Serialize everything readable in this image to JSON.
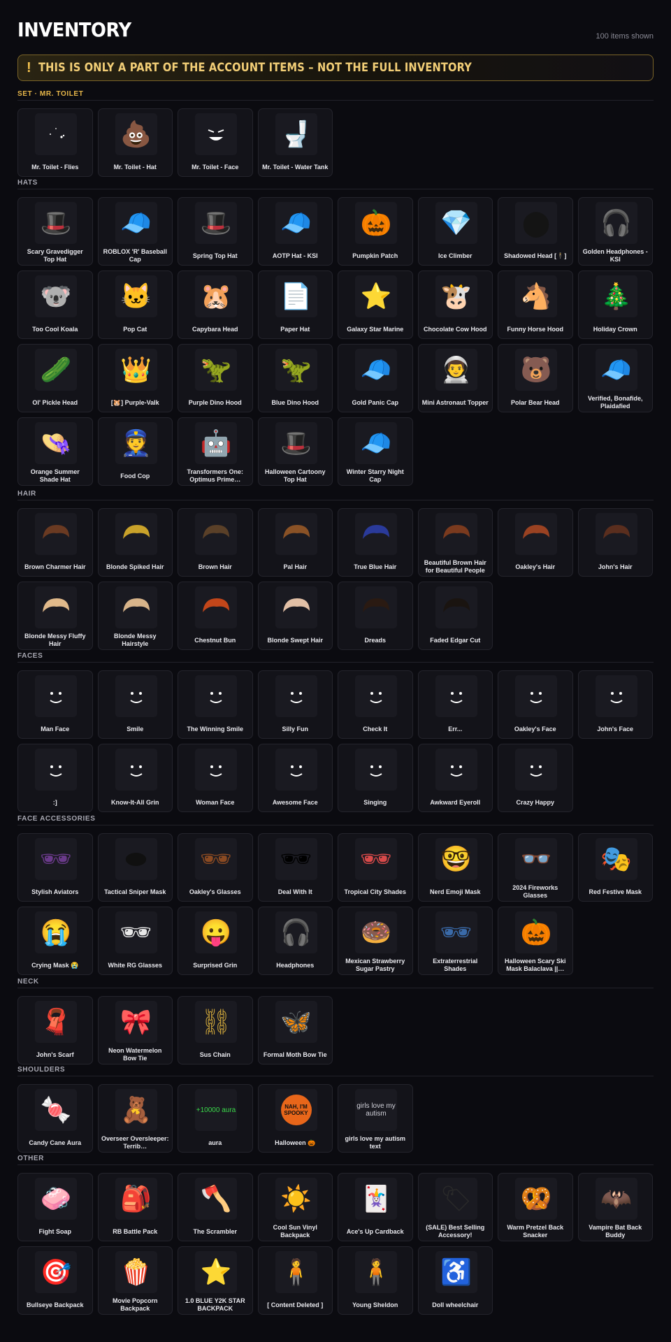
{
  "page": {
    "title": "INVENTORY",
    "count_label": "100 items shown",
    "banner_text": "THIS IS ONLY A PART OF THE ACCOUNT ITEMS – NOT THE FULL INVENTORY"
  },
  "sections": [
    {
      "label": "SET · MR. TOILET",
      "accent": "#e8b84a",
      "items": [
        {
          "name": "Mr. Toilet - Flies",
          "icon": "flies-icon",
          "color": "#ffffff"
        },
        {
          "name": "Mr. Toilet - Hat",
          "icon": "poop-hat-icon",
          "color": "#6b4a2e"
        },
        {
          "name": "Mr. Toilet - Face",
          "icon": "grin-face-icon",
          "color": "#ffffff"
        },
        {
          "name": "Mr. Toilet - Water Tank",
          "icon": "water-tank-icon",
          "color": "#c9c9c9"
        }
      ]
    },
    {
      "label": "HATS",
      "accent": "#a8a8b2",
      "items": [
        {
          "name": "Scary Gravedigger Top Hat",
          "icon": "top-hat-icon",
          "color": "#2b2b30"
        },
        {
          "name": "ROBLOX 'R' Baseball Cap",
          "icon": "cap-icon",
          "color": "#d12b2b"
        },
        {
          "name": "Spring Top Hat",
          "icon": "top-hat-icon",
          "color": "#2e8b3a"
        },
        {
          "name": "AOTP Hat - KSI",
          "icon": "cap-icon",
          "color": "#b33a2a"
        },
        {
          "name": "Pumpkin Patch",
          "icon": "pumpkin-icon",
          "color": "#f0b21a"
        },
        {
          "name": "Ice Climber",
          "icon": "crystal-icon",
          "color": "#4fa6d8"
        },
        {
          "name": "Shadowed Head [🕴]",
          "icon": "shadow-head-icon",
          "color": "#141414"
        },
        {
          "name": "Golden Headphones - KSI",
          "icon": "headphones-icon",
          "color": "#c9a23a"
        },
        {
          "name": "Too Cool Koala",
          "icon": "koala-icon",
          "color": "#8c8f95"
        },
        {
          "name": "Pop Cat",
          "icon": "cat-icon",
          "color": "#efe6d6"
        },
        {
          "name": "Capybara Head",
          "icon": "capybara-icon",
          "color": "#9a6a44"
        },
        {
          "name": "Paper Hat",
          "icon": "paper-hat-icon",
          "color": "#e9e9e9"
        },
        {
          "name": "Galaxy Star Marine",
          "icon": "star-hat-icon",
          "color": "#5b5fa8"
        },
        {
          "name": "Chocolate Cow Hood",
          "icon": "cow-icon",
          "color": "#f2ece2"
        },
        {
          "name": "Funny Horse Hood",
          "icon": "horse-icon",
          "color": "#a9693a"
        },
        {
          "name": "Holiday Crown",
          "icon": "wreath-icon",
          "color": "#2f8a3a"
        },
        {
          "name": "Ol' Pickle Head",
          "icon": "pickle-icon",
          "color": "#8da13a"
        },
        {
          "name": "[🐹] Purple-Valk",
          "icon": "valk-icon",
          "color": "#8b3fd6"
        },
        {
          "name": "Purple Dino Hood",
          "icon": "dino-icon",
          "color": "#8e4fd8"
        },
        {
          "name": "Blue Dino Hood",
          "icon": "dino-icon",
          "color": "#3a8ed8"
        },
        {
          "name": "Gold Panic Cap",
          "icon": "cap-icon",
          "color": "#d7b23a"
        },
        {
          "name": "Mini Astronaut Topper",
          "icon": "astronaut-icon",
          "color": "#c9ccd6"
        },
        {
          "name": "Polar Bear Head",
          "icon": "bear-icon",
          "color": "#d8d8d2"
        },
        {
          "name": "Verified, Bonafide, Plaidafied",
          "icon": "plaid-cap-icon",
          "color": "#4f9a6a"
        },
        {
          "name": "Orange Summer Shade Hat",
          "icon": "bucket-hat-icon",
          "color": "#c97a2a"
        },
        {
          "name": "Food Cop",
          "icon": "cop-icon",
          "color": "#2e3a66"
        },
        {
          "name": "Transformers One: Optimus Prime…",
          "icon": "robot-head-icon",
          "color": "#2a3a6a"
        },
        {
          "name": "Halloween Cartoony Top Hat",
          "icon": "top-hat-icon",
          "color": "#000000"
        },
        {
          "name": "Winter Starry Night Cap",
          "icon": "cap-icon",
          "color": "#6a9ad8"
        }
      ]
    },
    {
      "label": "HAIR",
      "accent": "#a8a8b2",
      "items": [
        {
          "name": "Brown Charmer Hair",
          "icon": "hair-icon",
          "color": "#6a3a22"
        },
        {
          "name": "Blonde Spiked Hair",
          "icon": "hair-icon",
          "color": "#c9a22a"
        },
        {
          "name": "Brown Hair",
          "icon": "hair-icon",
          "color": "#5a4028"
        },
        {
          "name": "Pal Hair",
          "icon": "hair-icon",
          "color": "#8a5226"
        },
        {
          "name": "True Blue Hair",
          "icon": "hair-icon",
          "color": "#2a3a9a"
        },
        {
          "name": "Beautiful Brown Hair for Beautiful People",
          "icon": "hair-icon",
          "color": "#7a3a1e"
        },
        {
          "name": "Oakley's Hair",
          "icon": "hair-icon",
          "color": "#9a4222"
        },
        {
          "name": "John's Hair",
          "icon": "hair-icon",
          "color": "#5a2e1e"
        },
        {
          "name": "Blonde Messy Fluffy Hair",
          "icon": "hair-icon",
          "color": "#e0b98a"
        },
        {
          "name": "Blonde Messy Hairstyle",
          "icon": "hair-icon",
          "color": "#d8b48a"
        },
        {
          "name": "Chestnut Bun",
          "icon": "hair-icon",
          "color": "#c2461a"
        },
        {
          "name": "Blonde Swept Hair",
          "icon": "hair-icon",
          "color": "#e2c0a6"
        },
        {
          "name": "Dreads",
          "icon": "hair-icon",
          "color": "#2a1a12"
        },
        {
          "name": "Faded Edgar Cut",
          "icon": "hair-icon",
          "color": "#1a1410"
        }
      ]
    },
    {
      "label": "FACES",
      "accent": "#a8a8b2",
      "items": [
        {
          "name": "Man Face",
          "icon": "face-icon",
          "color": "#111"
        },
        {
          "name": "Smile",
          "icon": "face-icon",
          "color": "#111"
        },
        {
          "name": "The Winning Smile",
          "icon": "face-icon",
          "color": "#111"
        },
        {
          "name": "Silly Fun",
          "icon": "face-icon",
          "color": "#111"
        },
        {
          "name": "Check It",
          "icon": "face-icon",
          "color": "#111"
        },
        {
          "name": "Err...",
          "icon": "face-icon",
          "color": "#111"
        },
        {
          "name": "Oakley's Face",
          "icon": "face-icon",
          "color": "#111"
        },
        {
          "name": "John's Face",
          "icon": "face-icon",
          "color": "#111"
        },
        {
          "name": ":]",
          "icon": "face-icon",
          "color": "#111"
        },
        {
          "name": "Know-It-All Grin",
          "icon": "face-icon",
          "color": "#111"
        },
        {
          "name": "Woman Face",
          "icon": "face-icon",
          "color": "#111"
        },
        {
          "name": "Awesome Face",
          "icon": "face-icon",
          "color": "#111"
        },
        {
          "name": "Singing",
          "icon": "face-icon",
          "color": "#111"
        },
        {
          "name": "Awkward Eyeroll",
          "icon": "face-icon",
          "color": "#111"
        },
        {
          "name": "Crazy Happy",
          "icon": "face-icon",
          "color": "#111"
        }
      ]
    },
    {
      "label": "FACE ACCESSORIES",
      "accent": "#a8a8b2",
      "items": [
        {
          "name": "Stylish Aviators",
          "icon": "glasses-icon",
          "color": "#6a3a8a"
        },
        {
          "name": "Tactical Sniper Mask",
          "icon": "mask-icon",
          "color": "#101010"
        },
        {
          "name": "Oakley's Glasses",
          "icon": "glasses-icon",
          "color": "#8a4a22"
        },
        {
          "name": "Deal With It",
          "icon": "pixel-glasses-icon",
          "color": "#000000"
        },
        {
          "name": "Tropical City Shades",
          "icon": "glasses-icon",
          "color": "#d84a4a"
        },
        {
          "name": "Nerd Emoji Mask",
          "icon": "nerd-emoji-icon",
          "color": "#f2c23a"
        },
        {
          "name": "2024 Fireworks Glasses",
          "icon": "2024-glasses-icon",
          "color": "#c9a23a"
        },
        {
          "name": "Red Festive Mask",
          "icon": "festive-mask-icon",
          "color": "#c93a2a"
        },
        {
          "name": "Crying Mask 😭",
          "icon": "crying-emoji-icon",
          "color": "#f2b23a"
        },
        {
          "name": "White RG Glasses",
          "icon": "glasses-icon",
          "color": "#e8e8e8"
        },
        {
          "name": "Surprised Grin",
          "icon": "surprised-face-icon",
          "color": "#ffffff"
        },
        {
          "name": "Headphones",
          "icon": "headphones-icon",
          "color": "#2a2a2a"
        },
        {
          "name": "Mexican Strawberry Sugar Pastry",
          "icon": "concha-icon",
          "color": "#e97aa8"
        },
        {
          "name": "Extraterrestrial Shades",
          "icon": "glasses-icon",
          "color": "#3a6aa8"
        },
        {
          "name": "Halloween Scary Ski Mask Balaclava ||…",
          "icon": "pumpkin-mask-icon",
          "color": "#e8661a"
        }
      ]
    },
    {
      "label": "NECK",
      "accent": "#a8a8b2",
      "items": [
        {
          "name": "John's Scarf",
          "icon": "scarf-icon",
          "color": "#1a3a2a"
        },
        {
          "name": "Neon Watermelon Bow Tie",
          "icon": "bow-tie-icon",
          "color": "#3ab84a"
        },
        {
          "name": "Sus Chain",
          "icon": "chain-icon",
          "color": "#c9a23a"
        },
        {
          "name": "Formal Moth Bow Tie",
          "icon": "moth-icon",
          "color": "#d8d8d8"
        }
      ]
    },
    {
      "label": "SHOULDERS",
      "accent": "#a8a8b2",
      "items": [
        {
          "name": "Candy Cane Aura",
          "icon": "candy-cane-icon",
          "color": "#d83a3a"
        },
        {
          "name": "Overseer Oversleeper: Terrib…",
          "icon": "teddy-bear-icon",
          "color": "#2a7a2a"
        },
        {
          "name": "aura",
          "icon": "aura-text-icon",
          "color": "#3ad84a",
          "text": "+10000 aura"
        },
        {
          "name": "Halloween 🎃",
          "icon": "speech-bubble-icon",
          "color": "#e8661a",
          "text": "NAH, I'M SPOOKY"
        },
        {
          "name": "girls love my autism text",
          "icon": "text-sign-icon",
          "color": "#d0d0d8",
          "text": "girls love my autism"
        }
      ]
    },
    {
      "label": "OTHER",
      "accent": "#a8a8b2",
      "items": [
        {
          "name": "Fight Soap",
          "icon": "soap-icon",
          "color": "#e84a8a"
        },
        {
          "name": "RB Battle Pack",
          "icon": "backpack-icon",
          "color": "#3ab84a"
        },
        {
          "name": "The Scrambler",
          "icon": "axe-icon",
          "color": "#d8d8d8"
        },
        {
          "name": "Cool Sun Vinyl Backpack",
          "icon": "sun-icon",
          "color": "#f2a21a"
        },
        {
          "name": "Ace's Up Cardback",
          "icon": "cards-icon",
          "color": "#e84a3a"
        },
        {
          "name": "(SALE) Best Selling Accessory!",
          "icon": "sale-card-icon",
          "color": "#2a2a2a"
        },
        {
          "name": "Warm Pretzel Back Snacker",
          "icon": "pretzel-icon",
          "color": "#c9823a"
        },
        {
          "name": "Vampire Bat Back Buddy",
          "icon": "bat-icon",
          "color": "#2a2a2a"
        },
        {
          "name": "Bullseye Backpack",
          "icon": "bullseye-icon",
          "color": "#c93a3a"
        },
        {
          "name": "Movie Popcorn Backpack",
          "icon": "popcorn-icon",
          "color": "#e84a3a"
        },
        {
          "name": "1.0 BLUE Y2K STAR BACKPACK",
          "icon": "star-backpack-icon",
          "color": "#5a9ad8"
        },
        {
          "name": "[ Content Deleted ]",
          "icon": "figures-icon",
          "color": "#c96a2a"
        },
        {
          "name": "Young Sheldon",
          "icon": "figures-icon",
          "color": "#8a8a8a"
        },
        {
          "name": "Doll wheelchair",
          "icon": "wheelchair-icon",
          "color": "#b8b8b8"
        }
      ]
    }
  ]
}
